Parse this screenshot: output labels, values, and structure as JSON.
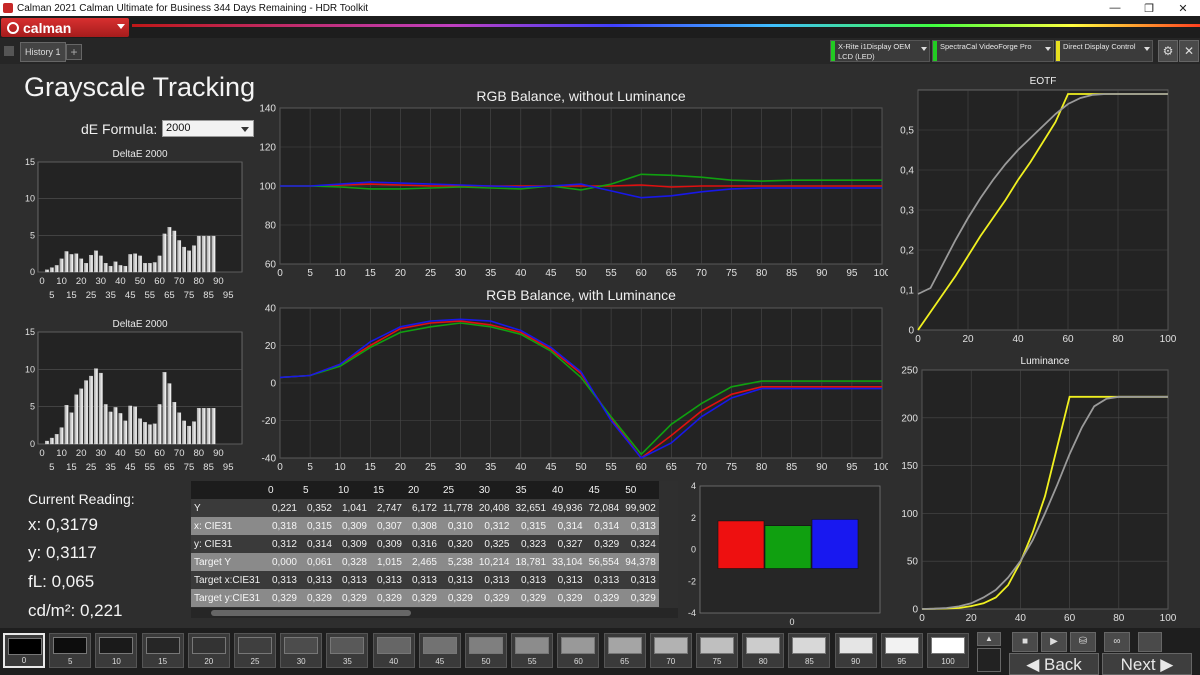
{
  "window": {
    "title": "Calman 2021 Calman Ultimate for Business 344 Days Remaining  - HDR Toolkit",
    "minimize": "—",
    "maximize": "❐",
    "close": "✕"
  },
  "header": {
    "logo_text": "calman",
    "tab_label": "History 1",
    "tab_add": "+",
    "devices": [
      {
        "line1": "X-Rite i1Display OEM",
        "line2": "LCD (LED)",
        "color": "#22cc22"
      },
      {
        "line1": "SpectraCal VideoForge Pro",
        "line2": "",
        "color": "#22cc22"
      },
      {
        "line1": "Direct Display Control",
        "line2": "",
        "color": "#e8e020"
      }
    ],
    "settings_icon": "⚙",
    "close_icon": "✕"
  },
  "main": {
    "title": "Grayscale Tracking",
    "de_formula_label": "dE Formula:",
    "de_formula_value": "2000"
  },
  "current_reading": {
    "title": "Current Reading:",
    "x": "x: 0,3179",
    "y": "y: 0,3117",
    "fl": "fL: 0,065",
    "cdm2": "cd/m²: 0,221"
  },
  "chart_data": [
    {
      "type": "bar",
      "title": "DeltaE 2000",
      "categories": [
        "0",
        "2.5",
        "5",
        "7.5",
        "10",
        "12.5",
        "15",
        "17.5",
        "20",
        "22.5",
        "25",
        "27.5",
        "30",
        "32.5",
        "35",
        "37.5",
        "40",
        "42.5",
        "45",
        "47.5",
        "50",
        "52.5",
        "55",
        "57.5",
        "60",
        "62.5",
        "65",
        "67.5",
        "70",
        "72.5",
        "75",
        "77.5",
        "80",
        "82.5",
        "85",
        "87.5",
        "90",
        "92.5",
        "95",
        "97.5",
        "100"
      ],
      "xticks_top": [
        "0",
        "10",
        "20",
        "30",
        "40",
        "50",
        "60",
        "70",
        "80",
        "90"
      ],
      "xticks_bottom": [
        "5",
        "15",
        "25",
        "35",
        "45",
        "55",
        "65",
        "75",
        "85",
        "95"
      ],
      "values": [
        0.3,
        0.6,
        0.9,
        1.8,
        2.8,
        2.4,
        2.5,
        1.8,
        1.2,
        2.3,
        2.9,
        2.2,
        1.2,
        0.8,
        1.4,
        0.9,
        0.8,
        2.4,
        2.5,
        2.2,
        1.2,
        1.2,
        1.3,
        2.2,
        5.2,
        6.1,
        5.6,
        4.3,
        3.4,
        2.9,
        3.6,
        4.9,
        4.9,
        4.9,
        4.9
      ],
      "ylim": [
        0,
        15
      ],
      "yticks": [
        "0",
        "5",
        "10",
        "15"
      ]
    },
    {
      "type": "bar",
      "title": "DeltaE 2000",
      "categories": [
        "0",
        "2.5",
        "5",
        "7.5",
        "10",
        "12.5",
        "15",
        "17.5",
        "20",
        "22.5",
        "25",
        "27.5",
        "30",
        "32.5",
        "35",
        "37.5",
        "40",
        "42.5",
        "45",
        "47.5",
        "50",
        "52.5",
        "55",
        "57.5",
        "60",
        "62.5",
        "65",
        "67.5",
        "70",
        "72.5",
        "75",
        "77.5",
        "80",
        "82.5",
        "85",
        "87.5",
        "90",
        "92.5",
        "95",
        "97.5",
        "100"
      ],
      "xticks_top": [
        "0",
        "10",
        "20",
        "30",
        "40",
        "50",
        "60",
        "70",
        "80",
        "90"
      ],
      "xticks_bottom": [
        "5",
        "15",
        "25",
        "35",
        "45",
        "55",
        "65",
        "75",
        "85",
        "95"
      ],
      "values": [
        0.4,
        0.8,
        1.3,
        2.2,
        5.2,
        4.2,
        6.6,
        7.4,
        8.5,
        9.1,
        10.1,
        9.5,
        5.3,
        4.3,
        4.9,
        4.1,
        3.1,
        5.1,
        5.0,
        3.4,
        2.9,
        2.6,
        2.7,
        5.3,
        9.6,
        8.1,
        5.6,
        4.2,
        3.1,
        2.4,
        3.0,
        4.8,
        4.8,
        4.8,
        4.8
      ],
      "ylim": [
        0,
        15
      ],
      "yticks": [
        "0",
        "5",
        "10",
        "15"
      ]
    },
    {
      "type": "line",
      "title": "RGB Balance, without Luminance",
      "xlim": [
        0,
        100
      ],
      "ylim": [
        60,
        140
      ],
      "xticks": [
        "0",
        "5",
        "10",
        "15",
        "20",
        "25",
        "30",
        "35",
        "40",
        "45",
        "50",
        "55",
        "60",
        "65",
        "70",
        "75",
        "80",
        "85",
        "90",
        "95",
        "100"
      ],
      "yticks": [
        "60",
        "80",
        "100",
        "120",
        "140"
      ],
      "x": [
        0,
        5,
        10,
        15,
        20,
        25,
        30,
        35,
        40,
        45,
        50,
        55,
        60,
        65,
        70,
        75,
        80,
        85,
        90,
        95,
        100
      ],
      "series": [
        {
          "color": "#e01010",
          "values": [
            100,
            100,
            100.5,
            101,
            100.5,
            100,
            100,
            100,
            100,
            100,
            100,
            100,
            100.5,
            99.5,
            100,
            100,
            100,
            100,
            100,
            100,
            100
          ]
        },
        {
          "color": "#10a010",
          "values": [
            100,
            100,
            99.5,
            98.5,
            98.5,
            99,
            99.5,
            99,
            98.5,
            100,
            98,
            101,
            106,
            105.5,
            104.5,
            103,
            102.5,
            103,
            103,
            103,
            103
          ]
        },
        {
          "color": "#1818e8",
          "values": [
            100,
            100,
            101,
            102,
            101.5,
            101,
            100.5,
            100,
            99.5,
            100,
            101,
            97.5,
            94,
            95,
            97,
            98.5,
            99,
            99,
            99,
            99,
            99
          ]
        }
      ]
    },
    {
      "type": "line",
      "title": "RGB Balance, with Luminance",
      "xlim": [
        0,
        100
      ],
      "ylim": [
        -40,
        40
      ],
      "xticks": [
        "0",
        "5",
        "10",
        "15",
        "20",
        "25",
        "30",
        "35",
        "40",
        "45",
        "50",
        "55",
        "60",
        "65",
        "70",
        "75",
        "80",
        "85",
        "90",
        "95",
        "100"
      ],
      "yticks": [
        "-40",
        "-20",
        "0",
        "20",
        "40"
      ],
      "x": [
        0,
        5,
        10,
        15,
        20,
        25,
        30,
        35,
        40,
        45,
        50,
        55,
        60,
        65,
        70,
        75,
        80,
        85,
        90,
        95,
        100
      ],
      "series": [
        {
          "color": "#e01010",
          "values": [
            3,
            4,
            10,
            20,
            29,
            32,
            33,
            31,
            27,
            18,
            5,
            -19,
            -42,
            -28,
            -15,
            -6,
            -2,
            -2,
            -2,
            -2,
            -2
          ]
        },
        {
          "color": "#10a010",
          "values": [
            3,
            4,
            9,
            19,
            27,
            30,
            32,
            30,
            26,
            17,
            3,
            -18,
            -38,
            -22,
            -11,
            -2,
            1,
            1,
            1,
            1,
            1
          ]
        },
        {
          "color": "#1818e8",
          "values": [
            3,
            4,
            10,
            22,
            30,
            33,
            34,
            33,
            28,
            19,
            6,
            -20,
            -43,
            -32,
            -18,
            -8,
            -3,
            -3,
            -3,
            -3,
            -3
          ]
        }
      ]
    },
    {
      "type": "line",
      "title": "EOTF",
      "xlim": [
        0,
        100
      ],
      "ylim": [
        0,
        0.6
      ],
      "xticks": [
        "0",
        "20",
        "40",
        "60",
        "80",
        "100"
      ],
      "yticks": [
        "0",
        "0,1",
        "0,2",
        "0,3",
        "0,4",
        "0,5"
      ],
      "x": [
        0,
        5,
        10,
        15,
        20,
        25,
        30,
        35,
        40,
        45,
        50,
        55,
        60,
        65,
        70,
        75,
        80,
        85,
        90,
        95,
        100
      ],
      "series": [
        {
          "color": "#f0f020",
          "values": [
            0,
            0.045,
            0.09,
            0.135,
            0.185,
            0.235,
            0.28,
            0.325,
            0.375,
            0.42,
            0.47,
            0.52,
            0.59,
            0.59,
            0.59,
            0.59,
            0.59,
            0.59,
            0.59,
            0.59,
            0.59
          ]
        },
        {
          "color": "#9a9a9a",
          "values": [
            0.09,
            0.105,
            0.165,
            0.225,
            0.28,
            0.33,
            0.375,
            0.415,
            0.45,
            0.48,
            0.51,
            0.54,
            0.565,
            0.58,
            0.588,
            0.59,
            0.59,
            0.59,
            0.59,
            0.59,
            0.59
          ]
        }
      ]
    },
    {
      "type": "line",
      "title": "Luminance",
      "xlim": [
        0,
        100
      ],
      "ylim": [
        0,
        250
      ],
      "xticks": [
        "0",
        "20",
        "40",
        "60",
        "80",
        "100"
      ],
      "yticks": [
        "0",
        "50",
        "100",
        "150",
        "200",
        "250"
      ],
      "x": [
        0,
        5,
        10,
        15,
        20,
        25,
        30,
        35,
        40,
        45,
        50,
        55,
        60,
        65,
        70,
        75,
        80,
        85,
        90,
        95,
        100
      ],
      "series": [
        {
          "color": "#f0f020",
          "values": [
            0,
            0.2,
            0.5,
            1,
            3,
            6,
            12,
            25,
            49,
            80,
            118,
            170,
            222,
            222,
            222,
            222,
            222,
            222,
            222,
            222,
            222
          ]
        },
        {
          "color": "#9a9a9a",
          "values": [
            0,
            0.3,
            1,
            2.7,
            6,
            12,
            20,
            33,
            50,
            72,
            100,
            130,
            162,
            190,
            212,
            220,
            222,
            222,
            222,
            222,
            222
          ]
        }
      ]
    },
    {
      "type": "bar",
      "title": "",
      "categories": [
        "R",
        "G",
        "B"
      ],
      "values": [
        0.6,
        0.3,
        0.7
      ],
      "colors": [
        "#ee1010",
        "#10a010",
        "#1818f0"
      ],
      "ylim": [
        -4,
        4
      ],
      "yticks": [
        "-4",
        "-2",
        "0",
        "2",
        "4"
      ],
      "xticks": [
        "0"
      ]
    }
  ],
  "table": {
    "columns": [
      "0",
      "5",
      "10",
      "15",
      "20",
      "25",
      "30",
      "35",
      "40",
      "45",
      "50"
    ],
    "rows": [
      {
        "label": "Y",
        "values": [
          "0,221",
          "0,352",
          "1,041",
          "2,747",
          "6,172",
          "11,778",
          "20,408",
          "32,651",
          "49,936",
          "72,084",
          "99,902"
        ]
      },
      {
        "label": "x: CIE31",
        "values": [
          "0,318",
          "0,315",
          "0,309",
          "0,307",
          "0,308",
          "0,310",
          "0,312",
          "0,315",
          "0,314",
          "0,314",
          "0,313"
        ]
      },
      {
        "label": "y: CIE31",
        "values": [
          "0,312",
          "0,314",
          "0,309",
          "0,309",
          "0,316",
          "0,320",
          "0,325",
          "0,323",
          "0,327",
          "0,329",
          "0,324"
        ]
      },
      {
        "label": "Target Y",
        "values": [
          "0,000",
          "0,061",
          "0,328",
          "1,015",
          "2,465",
          "5,238",
          "10,214",
          "18,781",
          "33,104",
          "56,554",
          "94,378"
        ]
      },
      {
        "label": "Target x:CIE31",
        "values": [
          "0,313",
          "0,313",
          "0,313",
          "0,313",
          "0,313",
          "0,313",
          "0,313",
          "0,313",
          "0,313",
          "0,313",
          "0,313"
        ]
      },
      {
        "label": "Target y:CIE31",
        "values": [
          "0,329",
          "0,329",
          "0,329",
          "0,329",
          "0,329",
          "0,329",
          "0,329",
          "0,329",
          "0,329",
          "0,329",
          "0,329"
        ]
      }
    ]
  },
  "swatches": [
    {
      "label": "0",
      "color": "#000000"
    },
    {
      "label": "5",
      "color": "#0d0d0d"
    },
    {
      "label": "10",
      "color": "#1a1a1a"
    },
    {
      "label": "15",
      "color": "#262626"
    },
    {
      "label": "20",
      "color": "#333333"
    },
    {
      "label": "25",
      "color": "#3f3f3f"
    },
    {
      "label": "30",
      "color": "#4c4c4c"
    },
    {
      "label": "35",
      "color": "#595959"
    },
    {
      "label": "40",
      "color": "#666666"
    },
    {
      "label": "45",
      "color": "#727272"
    },
    {
      "label": "50",
      "color": "#7f7f7f"
    },
    {
      "label": "55",
      "color": "#8c8c8c"
    },
    {
      "label": "60",
      "color": "#999999"
    },
    {
      "label": "65",
      "color": "#a5a5a5"
    },
    {
      "label": "70",
      "color": "#b2b2b2"
    },
    {
      "label": "75",
      "color": "#bfbfbf"
    },
    {
      "label": "80",
      "color": "#cccccc"
    },
    {
      "label": "85",
      "color": "#d8d8d8"
    },
    {
      "label": "90",
      "color": "#e5e5e5"
    },
    {
      "label": "95",
      "color": "#f2f2f2"
    },
    {
      "label": "100",
      "color": "#ffffff"
    }
  ],
  "controls": {
    "back_label": "◀ Back",
    "next_label": "Next ▶",
    "stop_icon": "■",
    "play_icon": "▶",
    "save_icon": "⛁",
    "loop_icon": "∞",
    "up_icon": "▲"
  }
}
